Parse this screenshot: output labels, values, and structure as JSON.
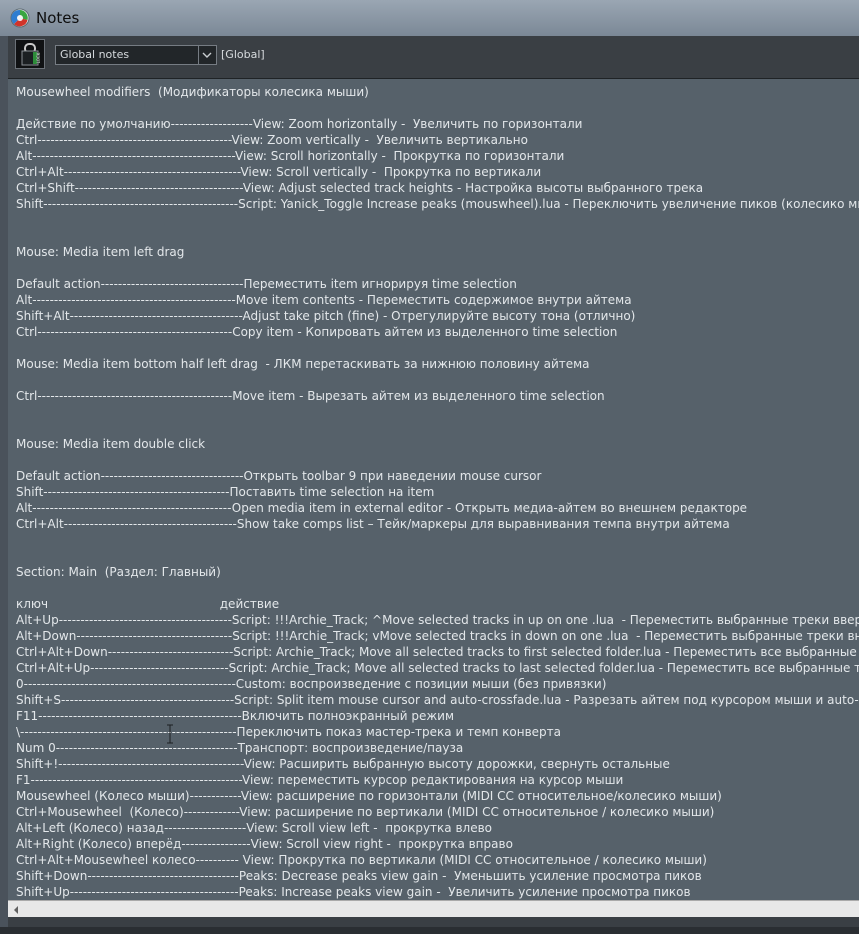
{
  "window": {
    "title": "Notes"
  },
  "toolbar": {
    "lock_icon_text": "LOCK",
    "notes_scope_selected": "Global notes",
    "scope_tag": "[Global]"
  },
  "notes": {
    "lines": [
      "Mousewheel modifiers  (Модификаторы колесика мыши)",
      "",
      "Действие по умолчанию-------------------View: Zoom horizontally -  Увеличить по горизонтали",
      "Ctrl---------------------------------------------View: Zoom vertically -  Увеличить вертикально",
      "Alt-----------------------------------------------View: Scroll horizontally -  Прокрутка по горизонтали",
      "Ctrl+Alt-----------------------------------------View: Scroll vertically -  Прокрутка по вертикали",
      "Ctrl+Shift---------------------------------------View: Adjust selected track heights - Настройка высоты выбранного трека",
      "Shift---------------------------------------------Script: Yanick_Toggle Increase peaks (mouswheel).lua - Переключить увеличение пиков (колесико мыш",
      "",
      "",
      "Mouse: Media item left drag",
      "",
      "Default action---------------------------------Переместить item игнорируя time selection",
      "Alt-----------------------------------------------Move item contents - Переместить содержимое внутри айтема",
      "Shift+Alt----------------------------------------Adjust take pitch (fine) - Отрегулируйте высоту тона (отлично)",
      "Ctrl---------------------------------------------Copy item - Копировать айтем из выделенного time selection",
      "",
      "Mouse: Media item bottom half left drag  - ЛКМ перетаскивать за нижнюю половину айтема",
      "",
      "Ctrl---------------------------------------------Move item - Вырезать айтем из выделенного time selection",
      "",
      "",
      "Mouse: Media item double click",
      "",
      "Default action---------------------------------Открыть toolbar 9 при наведении mouse cursor",
      "Shift-------------------------------------------Поставить time selection на item",
      "Alt----------------------------------------------Open media item in external editor - Открыть медиа-айтем во внешнем редакторе",
      "Ctrl+Alt----------------------------------------Show take comps list – Тейк/маркеры для выравнивания темпа внутри айтема",
      "",
      "",
      "Section: Main  (Раздел: Главный)",
      "",
      "ключ                                             действие",
      "Alt+Up----------------------------------------Script: !!!Archie_Track; ^Move selected tracks in up on one .lua  - Переместить выбранные треки вверх н",
      "Alt+Down------------------------------------Script: !!!Archie_Track; vMove selected tracks in down on one .lua  - Переместить выбранные треки вниз н",
      "Ctrl+Alt+Down-----------------------------Script: Archie_Track; Move all selected tracks to first selected folder.lua - Переместить все выбранные тр",
      "Ctrl+Alt+Up--------------------------------Script: Archie_Track; Move all selected tracks to last selected folder.lua - Переместить все выбранные тре",
      "0-------------------------------------------------Custom: воспроизведение с позиции мыши (без привязки)",
      "Shift+S----------------------------------------Script: Split item mouse cursor and auto-crossfade.lua - Разрезать айтем под курсором мыши и auto-cros",
      "F11-----------------------------------------------Включить полноэкранный режим",
      "\\--------------------------------------------------Переключить показ мастер-трека и темп конверта",
      "Num 0------------------------------------------Транспорт: воспроизведение/пауза",
      "Shift+!-------------------------------------------View: Расширить выбранную высоту дорожки, свернуть остальные",
      "F1-------------------------------------------------View: переместить курсор редактирования на курсор мыши",
      "Mousewheel (Колесо мыши)------------View: расширение по горизонтали (MIDI CC относительное/колесико мыши)",
      "Ctrl+Mousewheel  (Колесо)-------------View: расширение по вертикали (MIDI CC относительное / колесико мыши)",
      "Alt+Left (Колесо) назад-------------------View: Scroll view left -  прокрутка влево",
      "Alt+Right (Колесо) вперёд----------------View: Scroll view right -  прокрутка вправо",
      "Ctrl+Alt+Mousewheel колесо---------- View: Прокрутка по вертикали (MIDI CC относительное / колесико мыши)",
      "Shift+Down-----------------------------------Peaks: Decrease peaks view gain -  Уменьшить усиление просмотра пиков",
      "Shift+Up---------------------------------------Peaks: Increase peaks view gain -  Увеличить усиление просмотра пиков"
    ]
  },
  "colors": {
    "notes_background": "#56616a",
    "notes_text": "#e3e7ea",
    "titlebar": "#8794a2",
    "toolbar": "#3a3f44"
  }
}
